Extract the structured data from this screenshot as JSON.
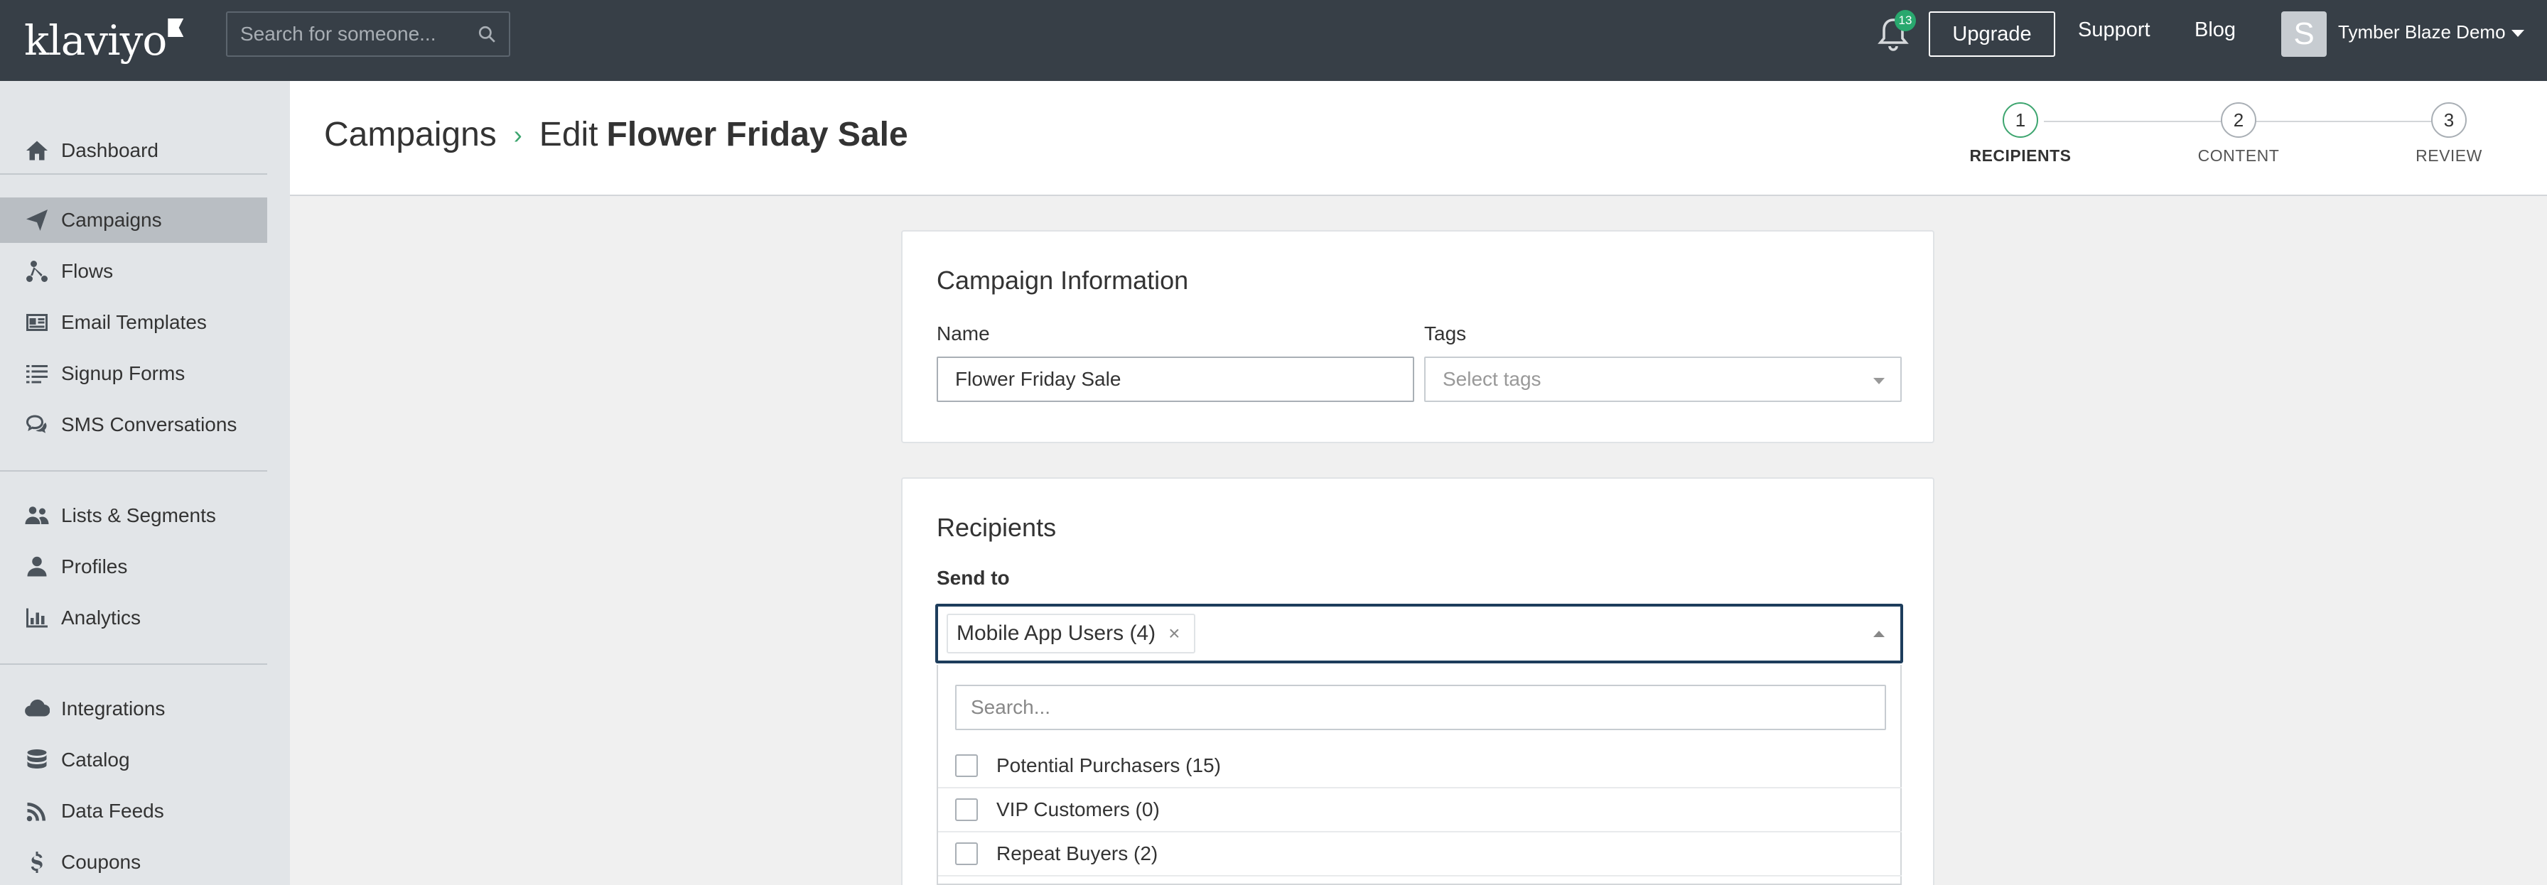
{
  "topbar": {
    "logo": "klaviyo",
    "search_placeholder": "Search for someone...",
    "notification_count": "13",
    "upgrade_label": "Upgrade",
    "support_label": "Support",
    "blog_label": "Blog",
    "avatar_letter": "S",
    "account_name": "Tymber Blaze Demo"
  },
  "sidebar": {
    "items": [
      {
        "label": "Dashboard",
        "icon": "home-icon"
      },
      {
        "label": "Campaigns",
        "icon": "paper-plane-icon",
        "active": true
      },
      {
        "label": "Flows",
        "icon": "flows-icon"
      },
      {
        "label": "Email Templates",
        "icon": "template-icon"
      },
      {
        "label": "Signup Forms",
        "icon": "form-list-icon"
      },
      {
        "label": "SMS Conversations",
        "icon": "chat-bubbles-icon"
      },
      {
        "label": "Lists & Segments",
        "icon": "users-icon"
      },
      {
        "label": "Profiles",
        "icon": "user-icon"
      },
      {
        "label": "Analytics",
        "icon": "bar-chart-icon"
      },
      {
        "label": "Integrations",
        "icon": "cloud-icon"
      },
      {
        "label": "Catalog",
        "icon": "database-icon"
      },
      {
        "label": "Data Feeds",
        "icon": "rss-icon"
      },
      {
        "label": "Coupons",
        "icon": "dollar-icon"
      }
    ]
  },
  "header": {
    "breadcrumb_root": "Campaigns",
    "breadcrumb_sep": "›",
    "edit_prefix": "Edit",
    "campaign_name": "Flower Friday Sale",
    "steps": [
      {
        "number": "1",
        "label": "RECIPIENTS",
        "current": true
      },
      {
        "number": "2",
        "label": "CONTENT"
      },
      {
        "number": "3",
        "label": "REVIEW"
      }
    ]
  },
  "campaign_info": {
    "title": "Campaign Information",
    "name_label": "Name",
    "name_value": "Flower Friday Sale",
    "tags_label": "Tags",
    "tags_placeholder": "Select tags"
  },
  "recipients": {
    "title": "Recipients",
    "send_to_label": "Send to",
    "selected_chip": "Mobile App Users (4)",
    "chip_remove": "×",
    "search_placeholder": "Search...",
    "options": [
      {
        "label": "Potential Purchasers (15)"
      },
      {
        "label": "VIP Customers (0)"
      },
      {
        "label": "Repeat Buyers (2)"
      }
    ]
  },
  "colors": {
    "topbar_bg": "#373f47",
    "sidebar_bg": "#e2e5e8",
    "accent_green": "#3da56f",
    "focus_border": "#1d3d5c"
  }
}
